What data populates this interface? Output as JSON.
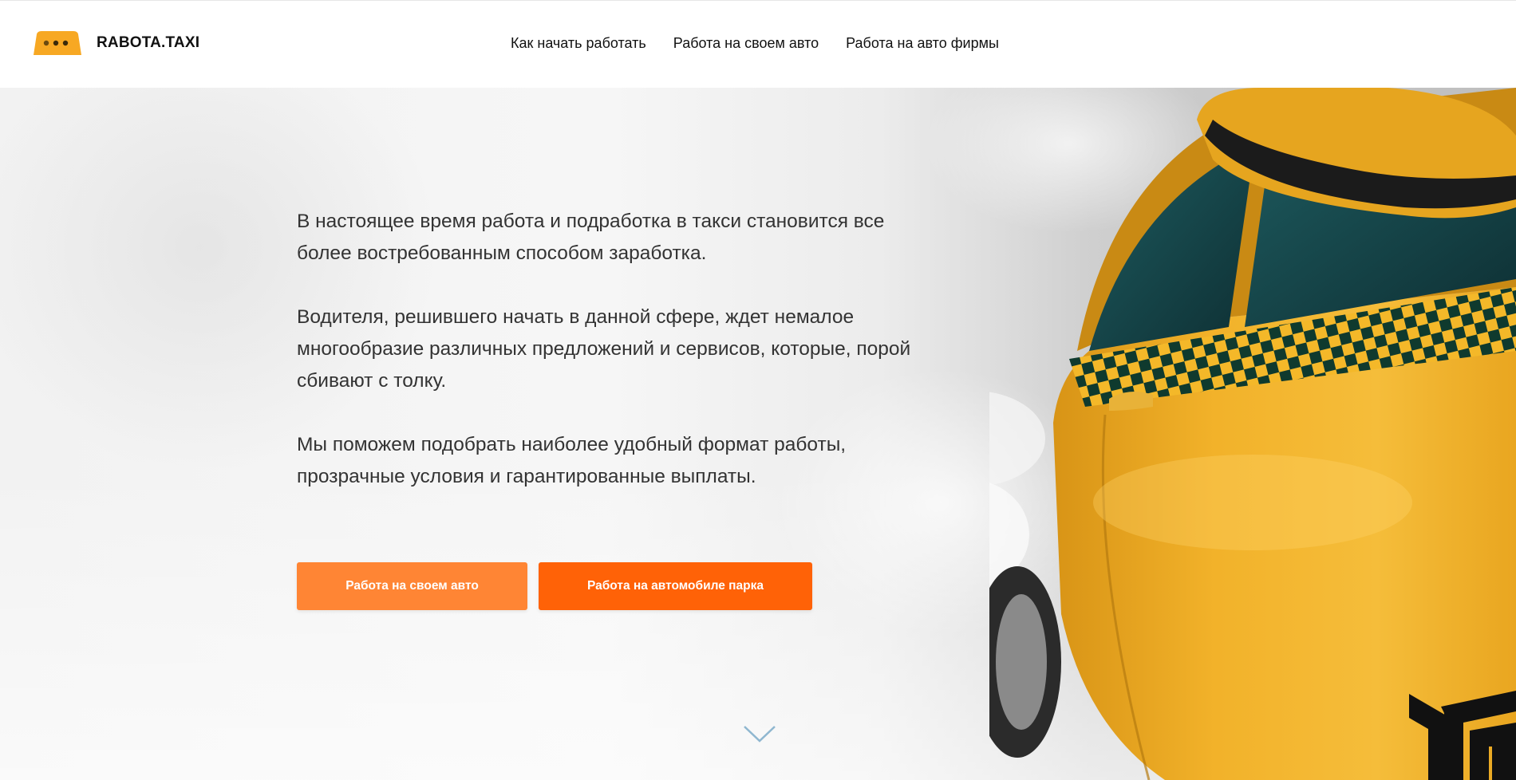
{
  "brand": {
    "name": "RABOTA.TAXI",
    "accent": "#f7a823"
  },
  "nav": {
    "items": [
      {
        "label": "Как начать работать"
      },
      {
        "label": "Работа на своем авто"
      },
      {
        "label": "Работа на авто фирмы"
      }
    ]
  },
  "hero": {
    "paragraphs": [
      "В настоящее время работа и подработка в такси становится все более востребованным способом заработка.",
      "Водителя, решившего начать в данной сфере, ждет немалое многообразие различных предложений и сервисов, которые, порой сбивают с толку.",
      "Мы поможем подобрать наиболее удобный формат работы, прозрачные условия и гарантированные выплаты."
    ],
    "buttons": {
      "own_car": {
        "label": "Работа на своем авто",
        "color": "#ff8534"
      },
      "park_car": {
        "label": "Работа на автомобиле парка",
        "color": "#ff6207"
      }
    },
    "scroll_icon": "chevron-down-icon"
  },
  "colors": {
    "taxi_yellow": "#f2b22a",
    "text": "#333333"
  }
}
